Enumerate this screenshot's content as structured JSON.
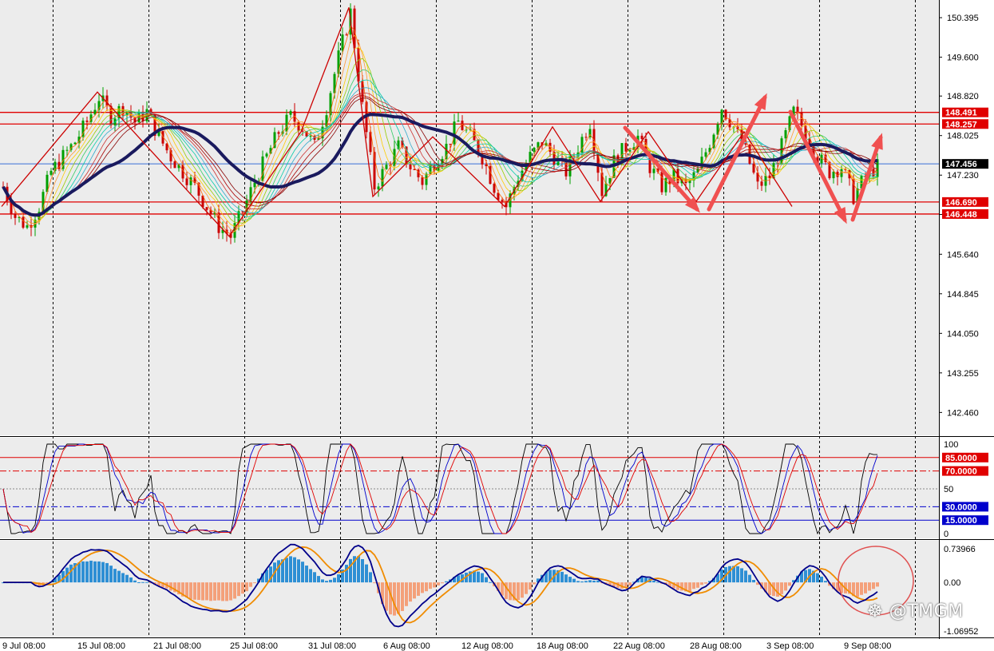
{
  "chart_data": [
    {
      "type": "candlestick",
      "instrument_axis": "price",
      "x_ticks": [
        "9 Jul 08:00",
        "15 Jul 08:00",
        "21 Jul 08:00",
        "25 Jul 08:00",
        "31 Jul 08:00",
        "6 Aug 08:00",
        "12 Aug 08:00",
        "18 Aug 08:00",
        "22 Aug 08:00",
        "28 Aug 08:00",
        "3 Sep 08:00",
        "9 Sep 08:00"
      ],
      "y_ticks": [
        150.395,
        149.6,
        148.82,
        148.025,
        147.23,
        146.44,
        145.64,
        144.845,
        144.05,
        143.255,
        142.46
      ],
      "ylim": [
        142.0,
        150.75
      ],
      "horizontal_levels": [
        {
          "value": 148.491,
          "label": "148.491",
          "color": "#e00000"
        },
        {
          "value": 148.257,
          "label": "148.257",
          "color": "#e00000"
        },
        {
          "value": 147.456,
          "label": "147.456",
          "color": "#000000"
        },
        {
          "value": 146.69,
          "label": "146.690",
          "color": "#e00000"
        },
        {
          "value": 146.448,
          "label": "146.448",
          "color": "#e00000"
        }
      ],
      "close_path": [
        [
          0,
          147.0
        ],
        [
          3,
          146.4
        ],
        [
          6,
          146.2
        ],
        [
          9,
          146.6
        ],
        [
          12,
          147.3
        ],
        [
          15,
          147.6
        ],
        [
          18,
          147.9
        ],
        [
          21,
          148.3
        ],
        [
          24,
          148.8
        ],
        [
          27,
          148.4
        ],
        [
          30,
          148.6
        ],
        [
          33,
          148.3
        ],
        [
          36,
          148.5
        ],
        [
          39,
          148.0
        ],
        [
          42,
          147.6
        ],
        [
          45,
          147.3
        ],
        [
          48,
          147.0
        ],
        [
          51,
          146.6
        ],
        [
          54,
          146.2
        ],
        [
          57,
          146.0
        ],
        [
          60,
          146.5
        ],
        [
          63,
          147.1
        ],
        [
          66,
          147.6
        ],
        [
          69,
          148.1
        ],
        [
          72,
          148.4
        ],
        [
          75,
          148.2
        ],
        [
          78,
          147.8
        ],
        [
          81,
          148.6
        ],
        [
          84,
          149.6
        ],
        [
          87,
          150.5
        ],
        [
          90,
          148.6
        ],
        [
          93,
          147.0
        ],
        [
          96,
          147.4
        ],
        [
          99,
          147.8
        ],
        [
          102,
          147.4
        ],
        [
          105,
          147.1
        ],
        [
          108,
          147.5
        ],
        [
          111,
          147.8
        ],
        [
          114,
          148.3
        ],
        [
          117,
          148.0
        ],
        [
          120,
          147.6
        ],
        [
          123,
          147.0
        ],
        [
          126,
          146.6
        ],
        [
          129,
          147.2
        ],
        [
          132,
          147.6
        ],
        [
          135,
          147.9
        ],
        [
          138,
          147.6
        ],
        [
          141,
          147.3
        ],
        [
          144,
          147.8
        ],
        [
          147,
          148.3
        ],
        [
          150,
          146.9
        ],
        [
          153,
          147.5
        ],
        [
          156,
          147.8
        ],
        [
          159,
          148.0
        ],
        [
          162,
          147.4
        ],
        [
          165,
          147.0
        ],
        [
          168,
          147.2
        ],
        [
          171,
          147.0
        ],
        [
          174,
          147.3
        ],
        [
          177,
          147.9
        ],
        [
          180,
          148.6
        ],
        [
          183,
          148.2
        ],
        [
          186,
          147.7
        ],
        [
          189,
          147.0
        ],
        [
          192,
          147.2
        ],
        [
          195,
          147.8
        ],
        [
          198,
          148.5
        ],
        [
          201,
          148.1
        ],
        [
          204,
          147.6
        ],
        [
          207,
          147.3
        ],
        [
          210,
          147.4
        ],
        [
          213,
          146.8
        ],
        [
          216,
          147.2
        ],
        [
          219,
          147.4
        ]
      ],
      "pattern_annotations": [
        "zigzag",
        "arrows"
      ],
      "colors": {
        "bull": "#00a000",
        "bear": "#cc0000",
        "ma_thick": "#1a1a5e",
        "level": "#e00000"
      }
    },
    {
      "type": "line",
      "name": "stochastic",
      "y_ticks": [
        "100",
        "50",
        "0"
      ],
      "levels": [
        {
          "value": 85,
          "label": "85.0000",
          "color": "#e00000"
        },
        {
          "value": 70,
          "label": "70.0000",
          "color": "#e00000"
        },
        {
          "value": 30,
          "label": "30.0000",
          "color": "#0000cc"
        },
        {
          "value": 15,
          "label": "15.0000",
          "color": "#0000cc"
        }
      ],
      "ylim": [
        0,
        100
      ]
    },
    {
      "type": "bar",
      "name": "macd",
      "y_ticks": [
        "0.73966",
        "0.00",
        "-1.06952"
      ],
      "ylim": [
        -1.06952,
        0.73966
      ],
      "colors": {
        "positive": "#2e8fd4",
        "negative": "#f4a07a",
        "signal": "#f08c00",
        "macd": "#00008b"
      }
    }
  ],
  "watermark": "@TMGM"
}
